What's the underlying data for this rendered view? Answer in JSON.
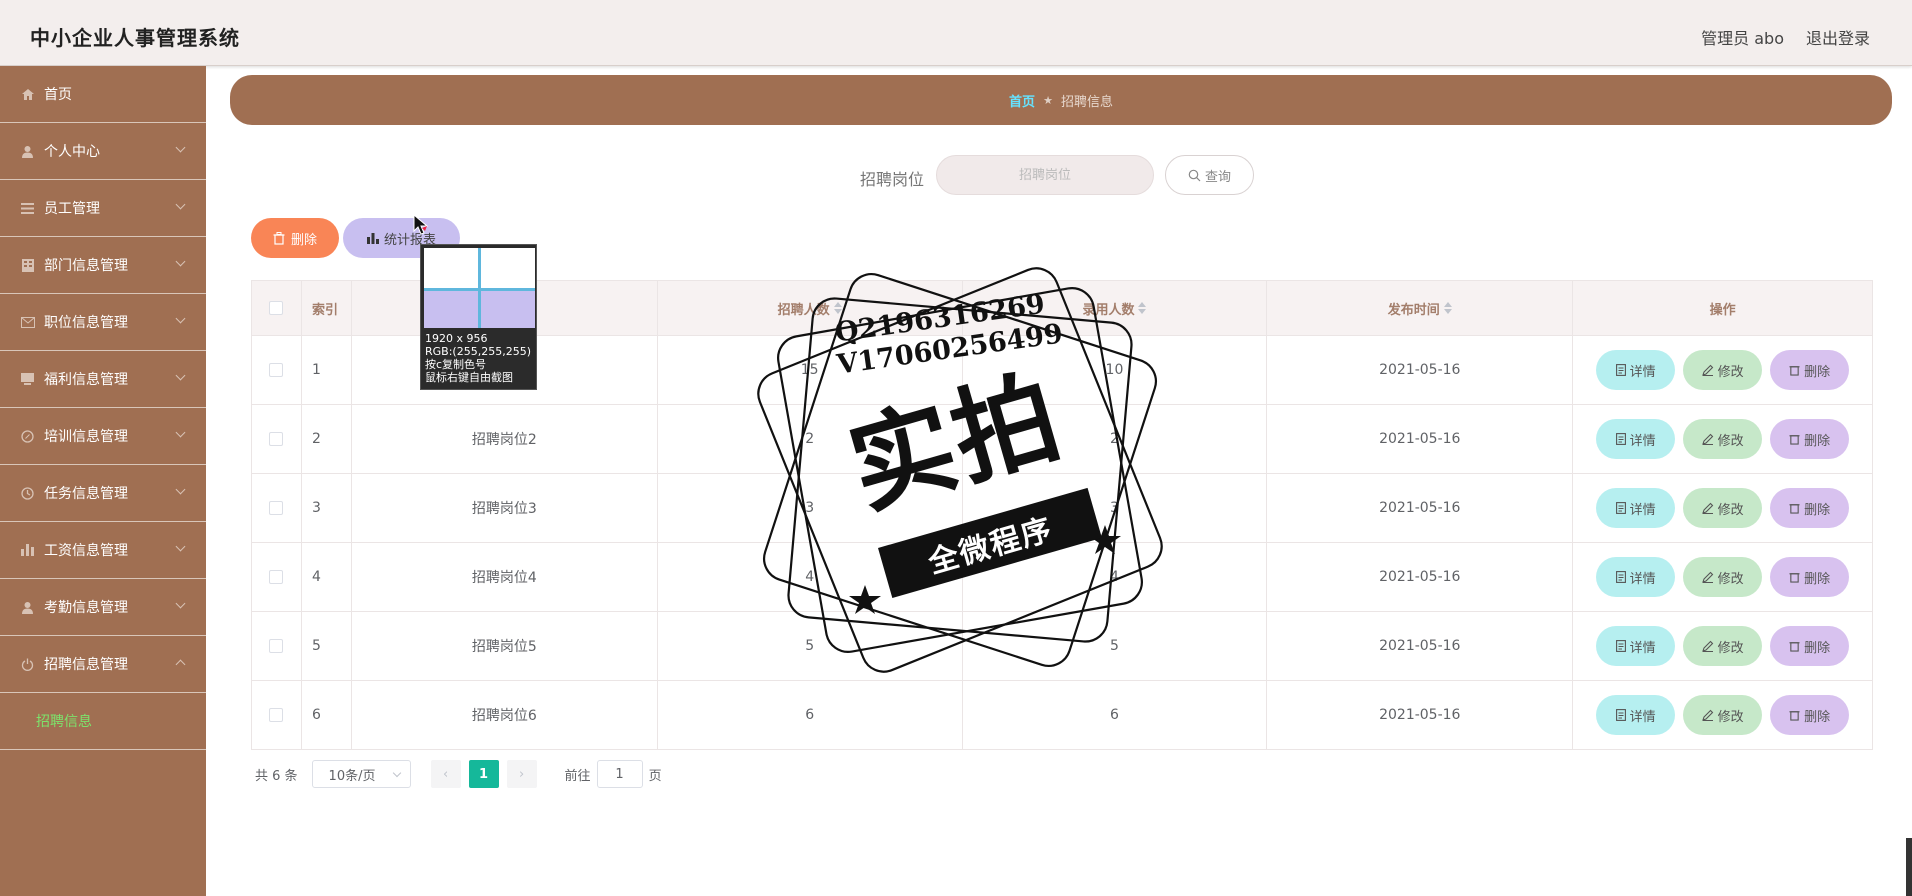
{
  "header": {
    "app_title": "中小企业人事管理系统",
    "user": "管理员 abo",
    "logout": "退出登录"
  },
  "sidebar": {
    "items": [
      {
        "label": "首页",
        "icon": "home-icon"
      },
      {
        "label": "个人中心",
        "icon": "user-icon"
      },
      {
        "label": "员工管理",
        "icon": "list-icon"
      },
      {
        "label": "部门信息管理",
        "icon": "building-icon"
      },
      {
        "label": "职位信息管理",
        "icon": "mail-icon"
      },
      {
        "label": "福利信息管理",
        "icon": "gift-icon"
      },
      {
        "label": "培训信息管理",
        "icon": "compass-icon"
      },
      {
        "label": "任务信息管理",
        "icon": "clock-icon"
      },
      {
        "label": "工资信息管理",
        "icon": "chart-icon"
      },
      {
        "label": "考勤信息管理",
        "icon": "user-icon"
      },
      {
        "label": "招聘信息管理",
        "icon": "power-icon"
      }
    ],
    "sub_item": "招聘信息"
  },
  "breadcrumb": {
    "home": "首页",
    "separator": "★",
    "current": "招聘信息"
  },
  "search": {
    "label": "招聘岗位",
    "placeholder": "招聘岗位",
    "button": "查询"
  },
  "toolbar": {
    "delete": "删除",
    "stats": "统计报表"
  },
  "table": {
    "headers": {
      "index": "索引",
      "num": "招聘人数",
      "hired": "录用人数",
      "date": "发布时间",
      "ops": "操作"
    },
    "rows": [
      {
        "idx": "1",
        "name": "",
        "num": "15",
        "hired": "10",
        "date": "2021-05-16"
      },
      {
        "idx": "2",
        "name": "招聘岗位2",
        "num": "2",
        "hired": "2",
        "date": "2021-05-16"
      },
      {
        "idx": "3",
        "name": "招聘岗位3",
        "num": "3",
        "hired": "3",
        "date": "2021-05-16"
      },
      {
        "idx": "4",
        "name": "招聘岗位4",
        "num": "4",
        "hired": "4",
        "date": "2021-05-16"
      },
      {
        "idx": "5",
        "name": "招聘岗位5",
        "num": "5",
        "hired": "5",
        "date": "2021-05-16"
      },
      {
        "idx": "6",
        "name": "招聘岗位6",
        "num": "6",
        "hired": "6",
        "date": "2021-05-16"
      }
    ],
    "op_labels": {
      "detail": "详情",
      "edit": "修改",
      "delete": "删除"
    }
  },
  "pagination": {
    "total": "共 6 条",
    "page_size": "10条/页",
    "current_page": "1",
    "goto_label": "前往",
    "goto_value": "1",
    "page_suffix": "页"
  },
  "picker": {
    "size": "1920 x 956",
    "rgb": "RGB:(255,255,255)",
    "hint1": "按c复制色号",
    "hint2": "鼠标右键自由截图"
  },
  "watermark": {
    "qq": "Q2196316269",
    "vx": "V17060256499",
    "big": "实拍",
    "ribbon": "全微程序"
  },
  "colors": {
    "accent": "#a06f52",
    "submenu_active": "#7de36b",
    "page_active": "#15b89a"
  }
}
